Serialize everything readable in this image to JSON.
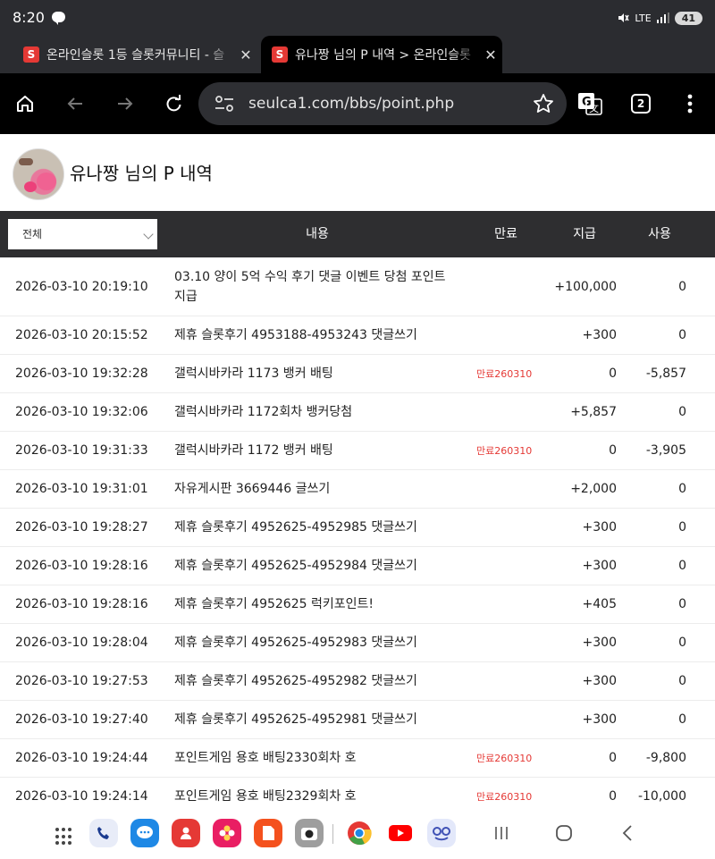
{
  "status_bar": {
    "time": "8:20",
    "network": "LTE",
    "battery": "41"
  },
  "tabs": [
    {
      "title": "온라인슬롯 1등 슬롯커뮤니티 - 슬",
      "active": false
    },
    {
      "title": "유나짱 님의 P 내역 > 온라인슬롯",
      "active": true
    }
  ],
  "toolbar": {
    "url": "seulca1.com/bbs/point.php",
    "tab_count": "2"
  },
  "page": {
    "title": "유나짱 님의 P 내역"
  },
  "table": {
    "filter_value": "전체",
    "headers": {
      "content": "내용",
      "expire": "만료",
      "give": "지급",
      "use": "사용"
    },
    "rows": [
      {
        "date": "2026-03-10 20:19:10",
        "content": "03.10 양이 5억 수익 후기 댓글 이벤트 당첨 포인트 지급",
        "expire": "",
        "give": "+100,000",
        "use": "0"
      },
      {
        "date": "2026-03-10 20:15:52",
        "content": "제휴 슬롯후기 4953188-4953243 댓글쓰기",
        "expire": "",
        "give": "+300",
        "use": "0"
      },
      {
        "date": "2026-03-10 19:32:28",
        "content": "갤럭시바카라 1173 뱅커 배팅",
        "expire": "만료260310",
        "give": "0",
        "use": "-5,857"
      },
      {
        "date": "2026-03-10 19:32:06",
        "content": "갤럭시바카라 1172회차 뱅커당첨",
        "expire": "",
        "give": "+5,857",
        "use": "0"
      },
      {
        "date": "2026-03-10 19:31:33",
        "content": "갤럭시바카라 1172 뱅커 배팅",
        "expire": "만료260310",
        "give": "0",
        "use": "-3,905"
      },
      {
        "date": "2026-03-10 19:31:01",
        "content": "자유게시판 3669446 글쓰기",
        "expire": "",
        "give": "+2,000",
        "use": "0"
      },
      {
        "date": "2026-03-10 19:28:27",
        "content": "제휴 슬롯후기 4952625-4952985 댓글쓰기",
        "expire": "",
        "give": "+300",
        "use": "0"
      },
      {
        "date": "2026-03-10 19:28:16",
        "content": "제휴 슬롯후기 4952625-4952984 댓글쓰기",
        "expire": "",
        "give": "+300",
        "use": "0"
      },
      {
        "date": "2026-03-10 19:28:16",
        "content": "제휴 슬롯후기 4952625 럭키포인트!",
        "expire": "",
        "give": "+405",
        "use": "0"
      },
      {
        "date": "2026-03-10 19:28:04",
        "content": "제휴 슬롯후기 4952625-4952983 댓글쓰기",
        "expire": "",
        "give": "+300",
        "use": "0"
      },
      {
        "date": "2026-03-10 19:27:53",
        "content": "제휴 슬롯후기 4952625-4952982 댓글쓰기",
        "expire": "",
        "give": "+300",
        "use": "0"
      },
      {
        "date": "2026-03-10 19:27:40",
        "content": "제휴 슬롯후기 4952625-4952981 댓글쓰기",
        "expire": "",
        "give": "+300",
        "use": "0"
      },
      {
        "date": "2026-03-10 19:24:44",
        "content": "포인트게임 용호 배팅2330회차 호",
        "expire": "만료260310",
        "give": "0",
        "use": "-9,800"
      },
      {
        "date": "2026-03-10 19:24:14",
        "content": "포인트게임 용호 배팅2329회차 호",
        "expire": "만료260310",
        "give": "0",
        "use": "-10,000"
      }
    ]
  },
  "nav_apps": [
    {
      "name": "phone-app-icon",
      "color": "#e8ecf8"
    },
    {
      "name": "messages-app-icon",
      "color": "#1e88e5"
    },
    {
      "name": "contacts-app-icon",
      "color": "#e53935"
    },
    {
      "name": "gallery-app-icon",
      "color": "#e91e63"
    },
    {
      "name": "notes-app-icon",
      "color": "#f4511e"
    },
    {
      "name": "camera-app-icon",
      "color": "#9e9e9e"
    },
    {
      "name": "chrome-app-icon",
      "color": "#ffffff"
    },
    {
      "name": "youtube-app-icon",
      "color": "#ffffff"
    },
    {
      "name": "assistant-app-icon",
      "color": "#e3e8fa"
    }
  ],
  "colors": {
    "expire_red": "#e53935",
    "header_bg": "#2e2e30",
    "chrome_bg": "#2b2c30"
  }
}
